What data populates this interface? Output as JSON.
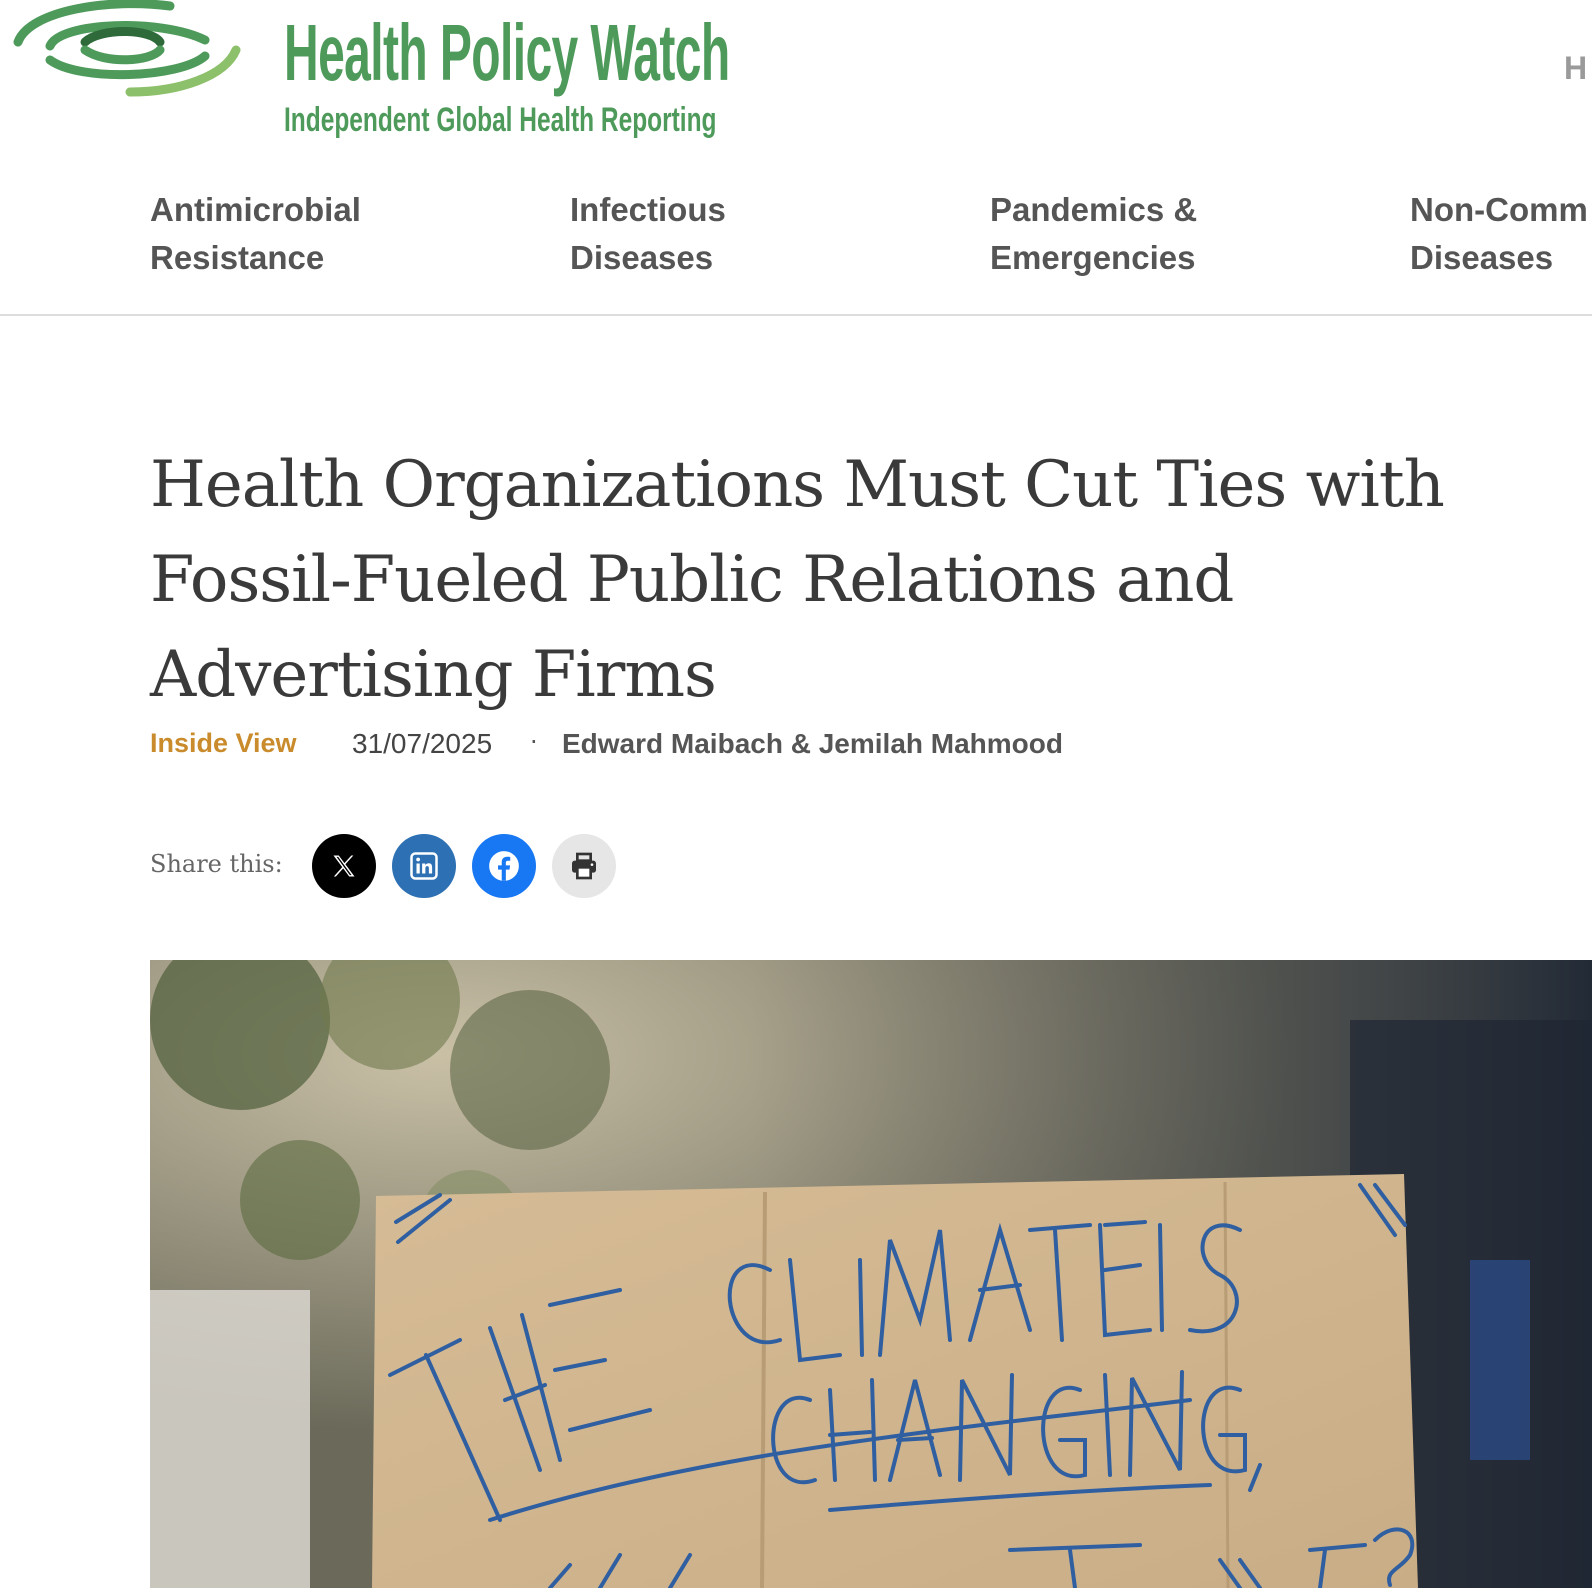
{
  "site": {
    "name": "Health Policy Watch",
    "tagline": "Independent Global Health Reporting",
    "header_cut_text": "H",
    "brand_color": "#4e9a5b"
  },
  "nav": {
    "items": [
      {
        "label": "Antimicrobial\nResistance"
      },
      {
        "label": "Infectious\nDiseases"
      },
      {
        "label": "Pandemics &\nEmergencies"
      },
      {
        "label": "Non-Comm\nDiseases"
      }
    ]
  },
  "article": {
    "title": "Health Organizations Must Cut Ties with Fossil-Fueled Public Relations and Advertising Firms",
    "category": "Inside View",
    "category_color": "#c98b2b",
    "date": "31/07/2025",
    "separator": "·",
    "authors": "Edward Maibach & Jemilah Mahmood"
  },
  "share": {
    "label": "Share this:",
    "buttons": [
      {
        "icon": "x-icon",
        "color": "#000000"
      },
      {
        "icon": "linkedin-icon",
        "color": "#2d70b3"
      },
      {
        "icon": "facebook-icon",
        "color": "#1877f2"
      },
      {
        "icon": "print-icon",
        "color": "#e6e6e6"
      }
    ]
  },
  "hero": {
    "sign_text": [
      "THE CLIMATE IS",
      "CHANGING,",
      "WHY AREN'T WE?"
    ]
  }
}
